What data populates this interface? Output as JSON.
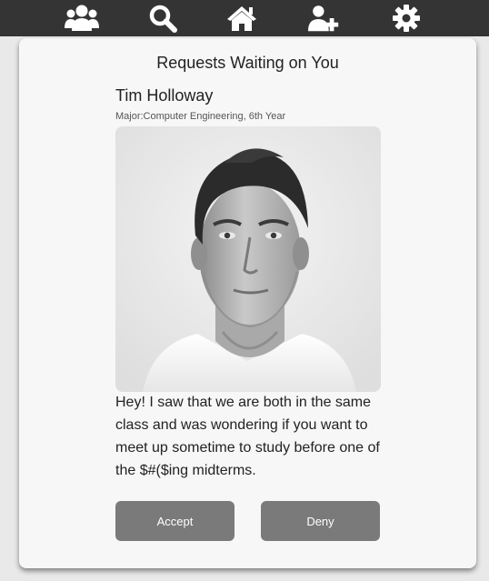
{
  "nav": {
    "items": [
      {
        "icon": "users-group-icon"
      },
      {
        "icon": "search-icon"
      },
      {
        "icon": "home-icon"
      },
      {
        "icon": "add-user-icon"
      },
      {
        "icon": "gear-icon"
      }
    ]
  },
  "card": {
    "title": "Requests Waiting on You",
    "request": {
      "name": "Tim Holloway",
      "major": "Major:Computer Engineering, 6th Year",
      "message": "Hey! I saw that we are both in the same class and was wondering if you want to meet up sometime to study before one of the $#($ing midterms."
    },
    "accept_label": "Accept",
    "deny_label": "Deny"
  },
  "colors": {
    "topbar": "#343434",
    "card_bg": "#f7f7f7",
    "button": "#7a7a7a"
  }
}
